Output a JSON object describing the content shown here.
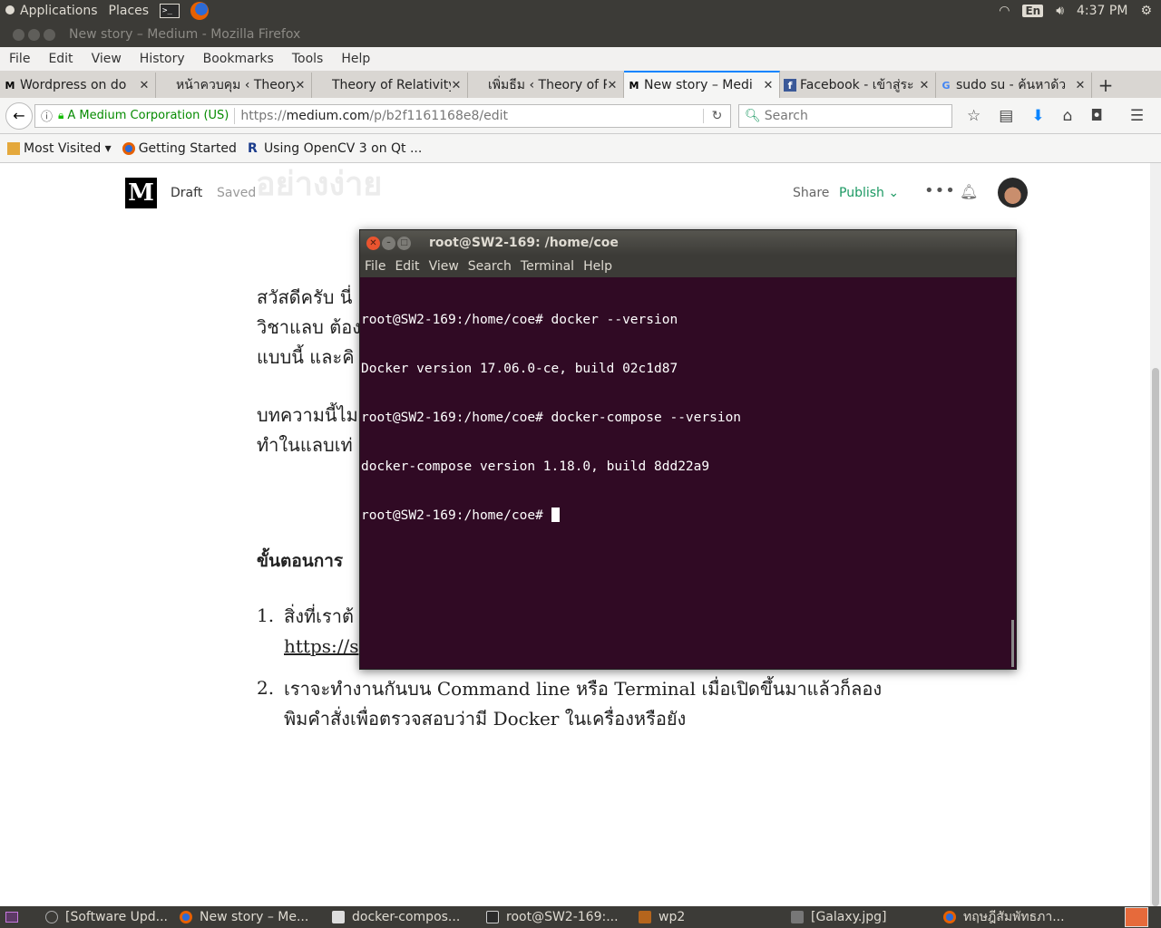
{
  "top_panel": {
    "applications": "Applications",
    "places": "Places",
    "keyboard": "En",
    "time": "4:37 PM"
  },
  "firefox": {
    "window_title": "New story – Medium - Mozilla Firefox",
    "menu": [
      "File",
      "Edit",
      "View",
      "History",
      "Bookmarks",
      "Tools",
      "Help"
    ],
    "tabs": [
      {
        "title": "Wordpress on do",
        "favicon": "M",
        "active": false
      },
      {
        "title": "หน้าควบคุม ‹ Theory o",
        "favicon": "",
        "active": false
      },
      {
        "title": "Theory of Relativity -",
        "favicon": "",
        "active": false
      },
      {
        "title": "เพิ่มธีม ‹ Theory of Re",
        "favicon": "",
        "active": false
      },
      {
        "title": "New story – Medi",
        "favicon": "M",
        "active": true
      },
      {
        "title": "Facebook - เข้าสู่ระ",
        "favicon": "f",
        "active": false
      },
      {
        "title": "sudo su - ค้นหาด้ว",
        "favicon": "G",
        "active": false
      }
    ],
    "identity": "A Medium Corporation (US)",
    "url_scheme": "https://",
    "url_host": "medium.com",
    "url_path": "/p/b2f1161168e8/edit",
    "search_placeholder": "Search",
    "bookmarks": [
      "Most Visited ▾",
      "Getting Started",
      "Using OpenCV 3 on Qt ..."
    ]
  },
  "medium": {
    "logo": "M",
    "draft": "Draft",
    "saved": "Saved",
    "ghost_title": "อย่างง่าย",
    "share": "Share",
    "publish": "Publish",
    "more": "•••",
    "para1": [
      "สวัสดีครับ นี่",
      "วิชาแลบ ต้อง",
      "แบบนี้ และคิ"
    ],
    "para2": [
      "บทความนี้ไม",
      "ทำในแลบเท่"
    ],
    "heading": "ขั้นตอนการ",
    "list": [
      {
        "num": "1.",
        "lines": [
          "สิ่งที่เราต้",
          "https://s"
        ]
      },
      {
        "num": "2.",
        "lines": [
          "เราจะทำงานกันบน Command line หรือ Terminal เมื่อเปิดขึ้นมาแล้วก็ลอง",
          "พิมคำสั่งเพื่อตรวจสอบว่ามี Docker ในเครื่องหรือยัง"
        ]
      }
    ]
  },
  "terminal": {
    "title": "root@SW2-169: /home/coe",
    "menu": [
      "File",
      "Edit",
      "View",
      "Search",
      "Terminal",
      "Help"
    ],
    "lines": [
      "root@SW2-169:/home/coe# docker --version",
      "Docker version 17.06.0-ce, build 02c1d87",
      "root@SW2-169:/home/coe# docker-compose --version",
      "docker-compose version 1.18.0, build 8dd22a9",
      "root@SW2-169:/home/coe# "
    ]
  },
  "taskbar": [
    {
      "label": "[Software Upd...",
      "icon": "software-updater-icon"
    },
    {
      "label": "New story – Me...",
      "icon": "firefox-icon"
    },
    {
      "label": "docker-compos...",
      "icon": "text-editor-icon"
    },
    {
      "label": "root@SW2-169:...",
      "icon": "terminal-icon"
    },
    {
      "label": "wp2",
      "icon": "folder-icon"
    },
    {
      "label": "[Galaxy.jpg]",
      "icon": "image-viewer-icon"
    },
    {
      "label": "ทฤษฎีสัมพัทธภา...",
      "icon": "firefox-icon"
    }
  ]
}
